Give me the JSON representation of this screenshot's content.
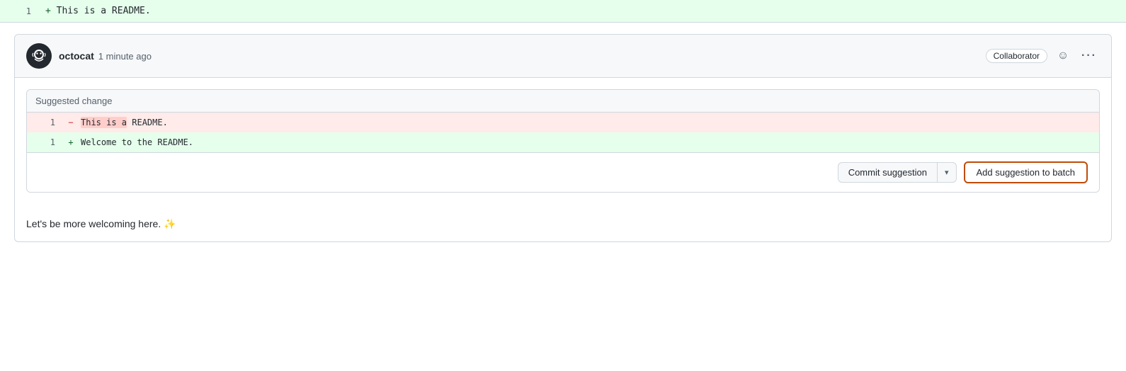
{
  "diff_top": {
    "line_number": "1",
    "sign": "+",
    "content": "This is a README."
  },
  "comment": {
    "author": "octocat",
    "time_ago": "1 minute ago",
    "collaborator_label": "Collaborator",
    "emoji_icon": "☺",
    "more_icon": "···",
    "suggested_change_header": "Suggested change",
    "diff_rows": [
      {
        "type": "removed",
        "line_number": "1",
        "sign": "-",
        "content": "This is a README.",
        "highlights": [
          "This is a"
        ]
      },
      {
        "type": "added",
        "line_number": "1",
        "sign": "+",
        "content": "Welcome to the README.",
        "highlights": []
      }
    ],
    "commit_suggestion_label": "Commit suggestion",
    "chevron": "▾",
    "add_to_batch_label": "Add suggestion to batch",
    "comment_text": "Let's be more welcoming here.",
    "sparkle": "✨"
  }
}
